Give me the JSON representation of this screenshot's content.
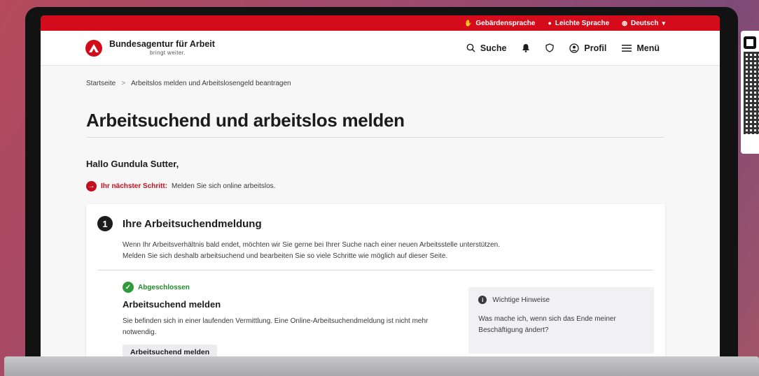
{
  "topbar": {
    "items": [
      {
        "icon": "sign-language-icon",
        "label": "Gebärdensprache"
      },
      {
        "icon": "easy-language-icon",
        "label": "Leichte Sprache"
      },
      {
        "icon": "globe-icon",
        "label": "Deutsch"
      }
    ]
  },
  "header": {
    "logo_title": "Bundesagentur für Arbeit",
    "logo_subtitle": "bringt weiter.",
    "search_label": "Suche",
    "profile_label": "Profil",
    "menu_label": "Menü"
  },
  "breadcrumb": {
    "home": "Startseite",
    "separator": ">",
    "current": "Arbeitslos melden und Arbeitslosengeld beantragen"
  },
  "page": {
    "title": "Arbeitsuchend und arbeitslos melden",
    "greeting": "Hallo Gundula Sutter,",
    "next_step_label": "Ihr nächster Schritt:",
    "next_step_text": "Melden Sie sich online arbeitslos."
  },
  "card": {
    "step_number": "1",
    "title": "Ihre Arbeitsuchendmeldung",
    "desc_line1": "Wenn Ihr Arbeitsverhältnis bald endet, möchten wir Sie gerne bei Ihrer Suche nach einer neuen Arbeitsstelle unterstützen.",
    "desc_line2": "Melden Sie sich deshalb arbeitsuchend und bearbeiten Sie so viele Schritte wie möglich auf dieser Seite.",
    "status": "Abgeschlossen",
    "sub_title": "Arbeitsuchend melden",
    "sub_desc": "Sie befinden sich in einer laufenden Vermittlung. Eine Online-Arbeitsuchendmeldung ist nicht mehr notwendig.",
    "button_label": "Arbeitsuchend melden",
    "hint_title": "Wichtige Hinweise",
    "hint_text": "Was mache ich, wenn sich das Ende meiner Beschäftigung ändert?"
  },
  "colors": {
    "brand_red": "#d40b1a",
    "success_green": "#2e9a3a"
  }
}
